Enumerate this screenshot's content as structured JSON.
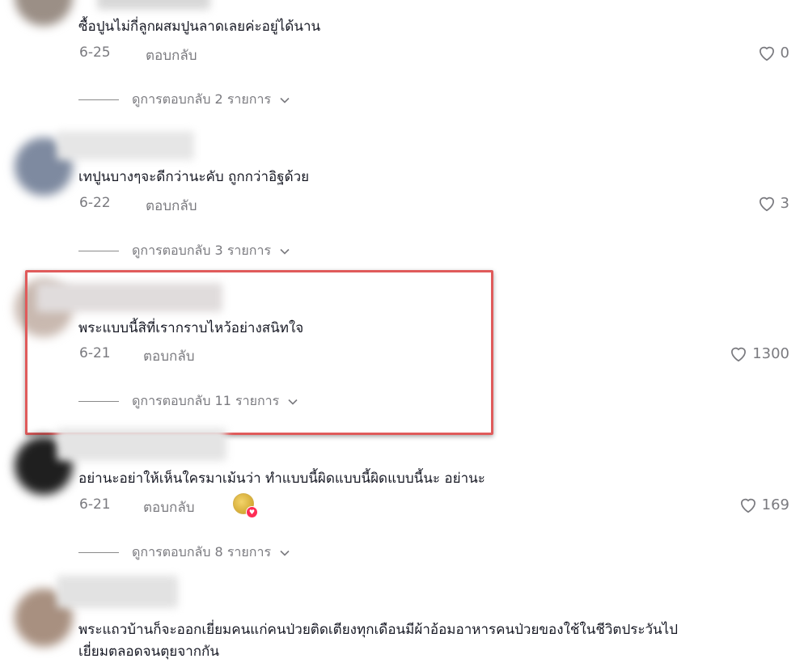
{
  "comments": [
    {
      "text": "ซื้อปูนไม่กี่ลูกผสมปูนลาดเลยค่ะอยู่ได้นาน",
      "date": "6-25",
      "reply_label": "ตอบกลับ",
      "likes": "0",
      "view_replies": "ดูการตอบกลับ 2 รายการ"
    },
    {
      "text": "เทปูนบางๆจะดีกว่านะคับ ถูกกว่าอิฐด้วย",
      "date": "6-22",
      "reply_label": "ตอบกลับ",
      "likes": "3",
      "view_replies": "ดูการตอบกลับ 3 รายการ"
    },
    {
      "text": "พระแบบนี้สิที่เรากราบไหว้อย่างสนิทใจ",
      "date": "6-21",
      "reply_label": "ตอบกลับ",
      "likes": "1300",
      "view_replies": "ดูการตอบกลับ 11 รายการ"
    },
    {
      "text": "อย่านะอย่าให้เห็นใครมาเม้นว่า ทำแบบนี้ผิดแบบนี้ผิดแบบนี้นะ อย่านะ",
      "date": "6-21",
      "reply_label": "ตอบกลับ",
      "likes": "169",
      "view_replies": "ดูการตอบกลับ 8 รายการ"
    },
    {
      "text_line1": "พระแถวบ้านก็จะออกเยี่ยมคนแก่คนป่วยติดเตียงทุกเดือนมีผ้าอ้อมอาหารคนป่วยของใช้ในชีวิตประวันไป",
      "text_line2": "เยี่ยมตลอดจนตุยจากกัน"
    }
  ],
  "colors": {
    "highlight_border": "#e05b5b",
    "muted_text": "#7a7a7f",
    "primary_text": "#161823",
    "heart_badge": "#fe2c55"
  }
}
